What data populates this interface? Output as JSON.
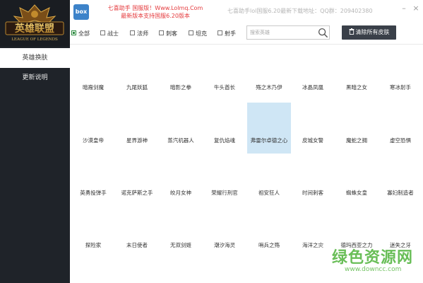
{
  "app": {
    "logo_text": "英雄联盟",
    "logo_subtext": "LEAGUE OF LEGENDS",
    "box_icon_text": "box",
    "promo_line1": "七喜助手  国服版！Www.Lolmq.Com",
    "promo_line2": "最新版本支持国服6.20版本",
    "titlebar_info": "七喜助手lol国服6.20最新下载地址：QQ群：209402380"
  },
  "sidebar": {
    "items": [
      {
        "label": "英雄换肤",
        "active": true
      },
      {
        "label": "更新说明",
        "active": false
      }
    ]
  },
  "filters": [
    {
      "label": "全部",
      "checked": true
    },
    {
      "label": "战士",
      "checked": false
    },
    {
      "label": "法师",
      "checked": false
    },
    {
      "label": "刺客",
      "checked": false
    },
    {
      "label": "坦克",
      "checked": false
    },
    {
      "label": "射手",
      "checked": false
    },
    {
      "label": "辅助",
      "checked": false
    }
  ],
  "search": {
    "placeholder": "搜索英雄",
    "icon": "search-icon"
  },
  "clear_button": {
    "label": "清除所有皮肤",
    "icon": "trash-icon"
  },
  "heroes": [
    [
      "暗裔剑魔",
      "九尾妖狐",
      "暗影之拳",
      "牛头酋长",
      "殇之木乃伊",
      "冰晶凤凰",
      "黑暗之女",
      "寒冰射手"
    ],
    [
      "沙漠皇帝",
      "星界游神",
      "蒸汽机器人",
      "复仇焰魂",
      "弗雷尔卓德之心",
      "皮城女警",
      "魔蛇之拥",
      "虚空恐惧"
    ],
    [
      "英勇投弹手",
      "诺克萨斯之手",
      "皎月女神",
      "荣耀行刑官",
      "祖安狂人",
      "时间刺客",
      "蜘蛛女皇",
      "寡妇制造者"
    ],
    [
      "探险家",
      "末日使者",
      "无双剑姬",
      "潮汐海灵",
      "哨兵之殇",
      "海洋之灾",
      "德玛西亚之力",
      "迷失之牙"
    ]
  ],
  "selected_hero": "弗雷尔卓德之心",
  "watermark": {
    "text": "绿色资源网",
    "url": "www.downcc.com"
  },
  "colors": {
    "sidebar_bg": "#1f2329",
    "selected_bg": "#cfe6f5",
    "promo_red": "#e4393c",
    "watermark_green": "#4fb33b"
  }
}
